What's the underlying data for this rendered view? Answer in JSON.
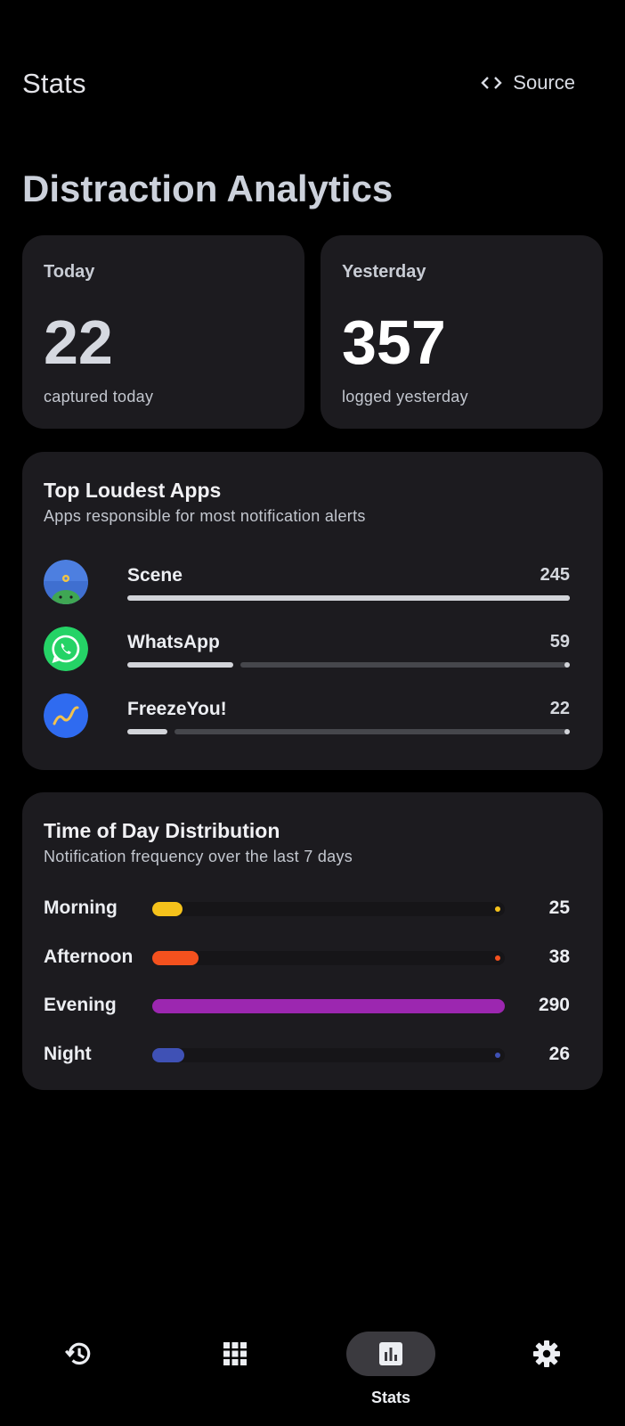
{
  "topbar": {
    "title": "Stats",
    "source_label": "Source"
  },
  "heading": "Distraction Analytics",
  "stats": [
    {
      "label": "Today",
      "value": "22",
      "sub": "captured today"
    },
    {
      "label": "Yesterday",
      "value": "357",
      "sub": "logged yesterday"
    }
  ],
  "top_apps": {
    "title": "Top Loudest Apps",
    "subtitle": "Apps responsible for most notification alerts",
    "items": [
      {
        "name": "Scene",
        "count": "245",
        "fraction": 1.0,
        "icon": "scene-app-icon"
      },
      {
        "name": "WhatsApp",
        "count": "59",
        "fraction": 0.24,
        "icon": "whatsapp-app-icon"
      },
      {
        "name": "FreezeYou!",
        "count": "22",
        "fraction": 0.09,
        "icon": "freezeyou-app-icon"
      }
    ]
  },
  "time_of_day": {
    "title": "Time of Day Distribution",
    "subtitle": "Notification frequency over the last 7 days",
    "max": 290,
    "items": [
      {
        "label": "Morning",
        "count": "25",
        "value": 25,
        "color": "#f5c21b"
      },
      {
        "label": "Afternoon",
        "count": "38",
        "value": 38,
        "color": "#f4511e"
      },
      {
        "label": "Evening",
        "count": "290",
        "value": 290,
        "color": "#9c27b0"
      },
      {
        "label": "Night",
        "count": "26",
        "value": 26,
        "color": "#3f51b5"
      }
    ]
  },
  "nav": {
    "items": [
      {
        "name": "history",
        "icon": "history-icon",
        "label": ""
      },
      {
        "name": "apps",
        "icon": "grid-icon",
        "label": ""
      },
      {
        "name": "stats",
        "icon": "bar-chart-icon",
        "label": "Stats",
        "active": true
      },
      {
        "name": "settings",
        "icon": "gear-icon",
        "label": ""
      }
    ]
  }
}
